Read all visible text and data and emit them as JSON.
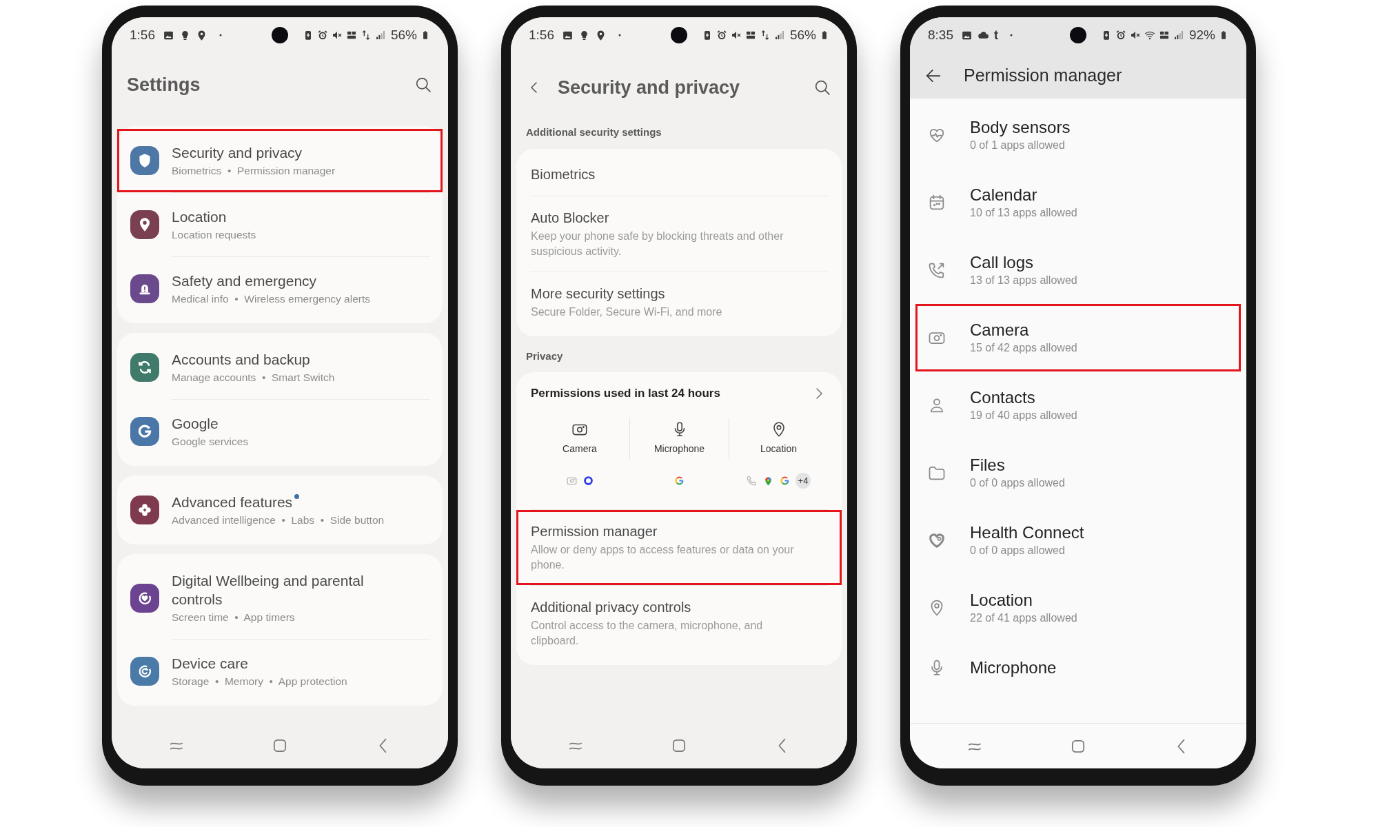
{
  "screens": [
    {
      "kind": "settings",
      "status_bar": {
        "time": "1:56",
        "battery": "56%",
        "left_icons": [
          {
            "kind": "image"
          },
          {
            "kind": "bulb"
          },
          {
            "kind": "pin"
          },
          {
            "kind": "dot"
          }
        ],
        "right_icons": [
          {
            "kind": "battery-saver"
          },
          {
            "kind": "alarm"
          },
          {
            "kind": "mute"
          },
          {
            "kind": "volte"
          },
          {
            "kind": "data"
          },
          {
            "kind": "signal"
          }
        ]
      },
      "title": "Settings",
      "groups": [
        {
          "items": [
            {
              "kind": "shield",
              "color": "#4d77a4",
              "title": "Security and privacy",
              "subtitle": "Biometrics  •  Permission manager",
              "highlighted": true,
              "dot": false
            },
            {
              "kind": "pin",
              "color": "#7b3f52",
              "title": "Location",
              "subtitle": "Location requests",
              "highlighted": false,
              "dot": false
            },
            {
              "kind": "siren",
              "color": "#6a4a8c",
              "title": "Safety and emergency",
              "subtitle": "Medical info  •  Wireless emergency alerts",
              "highlighted": false,
              "dot": false
            }
          ]
        },
        {
          "items": [
            {
              "kind": "sync",
              "color": "#3f7a6b",
              "title": "Accounts and backup",
              "subtitle": "Manage accounts  •  Smart Switch",
              "highlighted": false,
              "dot": false
            },
            {
              "kind": "g",
              "color": "#4a76a8",
              "title": "Google",
              "subtitle": "Google services",
              "highlighted": false,
              "dot": false
            }
          ]
        },
        {
          "items": [
            {
              "kind": "flower",
              "color": "#7f3a4e",
              "title": "Advanced features",
              "subtitle": "Advanced intelligence  •  Labs  •  Side button",
              "highlighted": false,
              "dot": true
            }
          ]
        },
        {
          "items": [
            {
              "kind": "wellbeing",
              "color": "#6b4390",
              "title": "Digital Wellbeing and parental controls",
              "subtitle": "Screen time  •  App timers",
              "highlighted": false,
              "dot": false
            },
            {
              "kind": "devicecare",
              "color": "#4a7aa8",
              "title": "Device care",
              "subtitle": "Storage  •  Memory  •  App protection",
              "highlighted": false,
              "dot": false
            }
          ]
        }
      ]
    },
    {
      "kind": "security",
      "status_bar": {
        "time": "1:56",
        "battery": "56%",
        "left_icons": [
          {
            "kind": "image"
          },
          {
            "kind": "bulb"
          },
          {
            "kind": "pin"
          },
          {
            "kind": "dot"
          }
        ],
        "right_icons": [
          {
            "kind": "battery-saver"
          },
          {
            "kind": "alarm"
          },
          {
            "kind": "mute"
          },
          {
            "kind": "volte"
          },
          {
            "kind": "data"
          },
          {
            "kind": "signal"
          }
        ]
      },
      "title": "Security and privacy",
      "sections": [
        {
          "label": "Additional security settings",
          "items": [
            {
              "title": "Biometrics",
              "highlighted": false
            },
            {
              "title": "Auto Blocker",
              "subtitle": "Keep your phone safe by blocking threats and other suspicious activity.",
              "highlighted": false
            },
            {
              "title": "More security settings",
              "subtitle": "Secure Folder, Secure Wi-Fi, and more",
              "highlighted": false
            }
          ]
        },
        {
          "label": "Privacy",
          "usage": {
            "title": "Permissions used in last 24 hours",
            "categories": [
              {
                "kind": "camera",
                "label": "Camera",
                "apps": [
                  {
                    "kind": "camera"
                  },
                  {
                    "kind": "ring"
                  }
                ]
              },
              {
                "kind": "mic",
                "label": "Microphone",
                "apps": [
                  {
                    "kind": "g"
                  }
                ]
              },
              {
                "kind": "pin",
                "label": "Location",
                "apps": [
                  {
                    "kind": "phone"
                  },
                  {
                    "kind": "map-pin"
                  },
                  {
                    "kind": "g"
                  }
                ],
                "more": "+4"
              }
            ]
          },
          "items": [
            {
              "title": "Permission manager",
              "subtitle": "Allow or deny apps to access features or data on your phone.",
              "highlighted": true
            },
            {
              "title": "Additional privacy controls",
              "subtitle": "Control access to the camera, microphone, and clipboard.",
              "highlighted": false
            }
          ]
        }
      ]
    },
    {
      "kind": "permissions",
      "status_bar": {
        "time": "8:35",
        "battery": "92%",
        "left_icons": [
          {
            "kind": "image"
          },
          {
            "kind": "cloud"
          },
          {
            "kind": "glyph",
            "text": "t"
          },
          {
            "kind": "dot"
          }
        ],
        "right_icons": [
          {
            "kind": "battery-saver"
          },
          {
            "kind": "alarm"
          },
          {
            "kind": "mute"
          },
          {
            "kind": "wifi"
          },
          {
            "kind": "volte"
          },
          {
            "kind": "signal"
          }
        ]
      },
      "title": "Permission manager",
      "items": [
        {
          "kind": "heart-pulse",
          "title": "Body sensors",
          "subtitle": "0 of 1 apps allowed",
          "highlighted": false
        },
        {
          "kind": "calendar",
          "title": "Calendar",
          "subtitle": "10 of 13 apps allowed",
          "highlighted": false
        },
        {
          "kind": "call-log",
          "title": "Call logs",
          "subtitle": "13 of 13 apps allowed",
          "highlighted": false
        },
        {
          "kind": "camera",
          "title": "Camera",
          "subtitle": "15 of 42 apps allowed",
          "highlighted": true
        },
        {
          "kind": "person",
          "title": "Contacts",
          "subtitle": "19 of 40 apps allowed",
          "highlighted": false
        },
        {
          "kind": "folder",
          "title": "Files",
          "subtitle": "0 of 0 apps allowed",
          "highlighted": false
        },
        {
          "kind": "health",
          "title": "Health Connect",
          "subtitle": "0 of 0 apps allowed",
          "highlighted": false
        },
        {
          "kind": "pin",
          "title": "Location",
          "subtitle": "22 of 41 apps allowed",
          "highlighted": false
        },
        {
          "kind": "mic",
          "title": "Microphone",
          "highlighted": false
        }
      ]
    }
  ]
}
